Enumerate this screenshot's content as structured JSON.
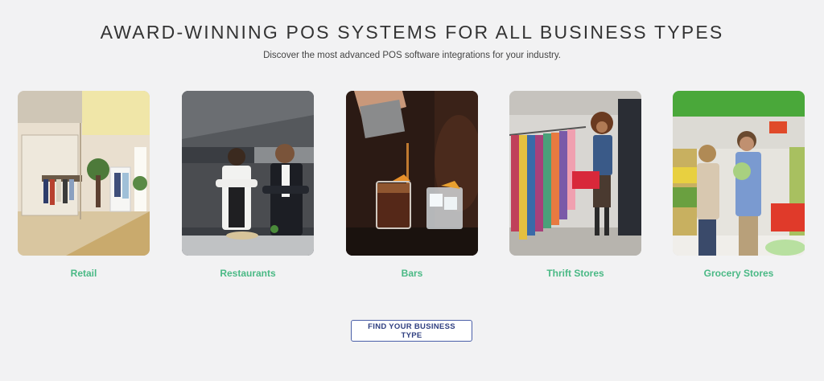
{
  "header": {
    "title": "AWARD-WINNING POS SYSTEMS FOR ALL BUSINESS TYPES",
    "subtitle": "Discover the most advanced POS software integrations for your industry."
  },
  "business_types": [
    {
      "label": "Retail",
      "image": "retail-store-photo"
    },
    {
      "label": "Restaurants",
      "image": "restaurant-chefs-photo"
    },
    {
      "label": "Bars",
      "image": "cocktail-pour-photo"
    },
    {
      "label": "Thrift Stores",
      "image": "thrift-shopper-photo"
    },
    {
      "label": "Grocery Stores",
      "image": "grocery-couple-photo"
    }
  ],
  "cta": {
    "label": "FIND YOUR BUSINESS TYPE"
  },
  "colors": {
    "accent_green": "#4ab985",
    "button_border": "#4a5fa8",
    "background": "#f2f2f3"
  }
}
